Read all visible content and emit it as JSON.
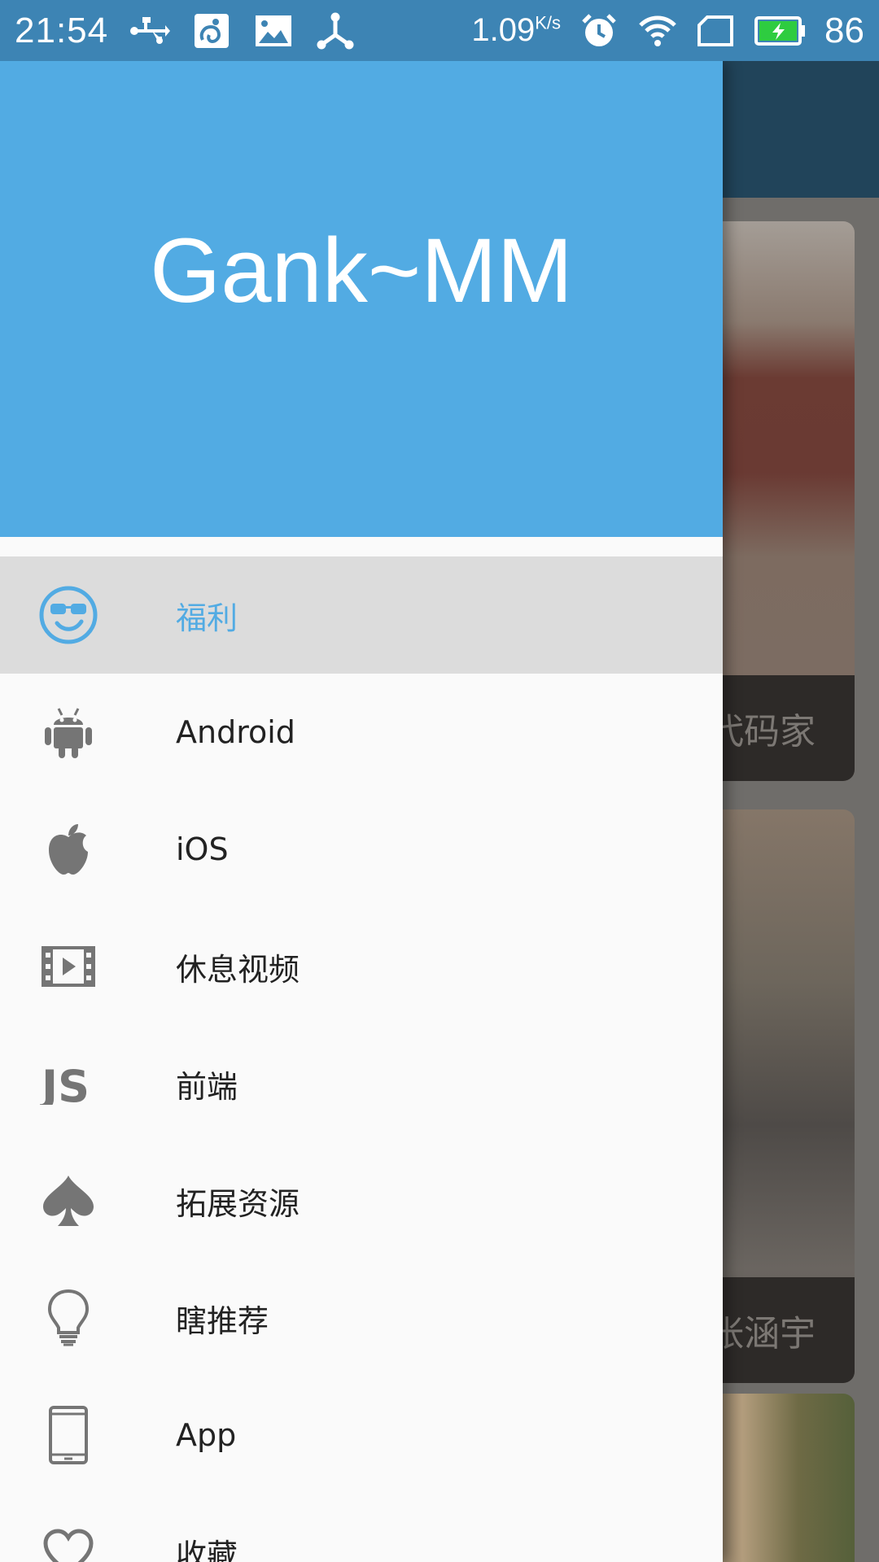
{
  "status_bar": {
    "time": "21:54",
    "speed_value": "1.09",
    "speed_unit": "K/s",
    "battery_percent": "86",
    "icons": [
      "usb-icon",
      "uc-browser-icon",
      "gallery-icon",
      "share-hub-icon",
      "alarm-icon",
      "wifi-icon",
      "sim-icon",
      "battery-charging-icon"
    ]
  },
  "drawer": {
    "title": "Gank~MM",
    "accent_color": "#52abe3",
    "items": [
      {
        "label": "福利",
        "icon": "smiley-sunglasses-icon",
        "selected": true
      },
      {
        "label": "Android",
        "icon": "android-icon"
      },
      {
        "label": "iOS",
        "icon": "apple-icon"
      },
      {
        "label": "休息视频",
        "icon": "film-icon"
      },
      {
        "label": "前端",
        "icon": "js-icon"
      },
      {
        "label": "拓展资源",
        "icon": "spade-icon"
      },
      {
        "label": "瞎推荐",
        "icon": "lightbulb-icon"
      },
      {
        "label": "App",
        "icon": "phone-icon"
      },
      {
        "label": "收藏",
        "icon": "heart-icon"
      }
    ]
  },
  "background": {
    "cards": [
      {
        "caption": "代码家"
      },
      {
        "caption": "张涵宇"
      },
      {
        "caption": ""
      }
    ]
  }
}
